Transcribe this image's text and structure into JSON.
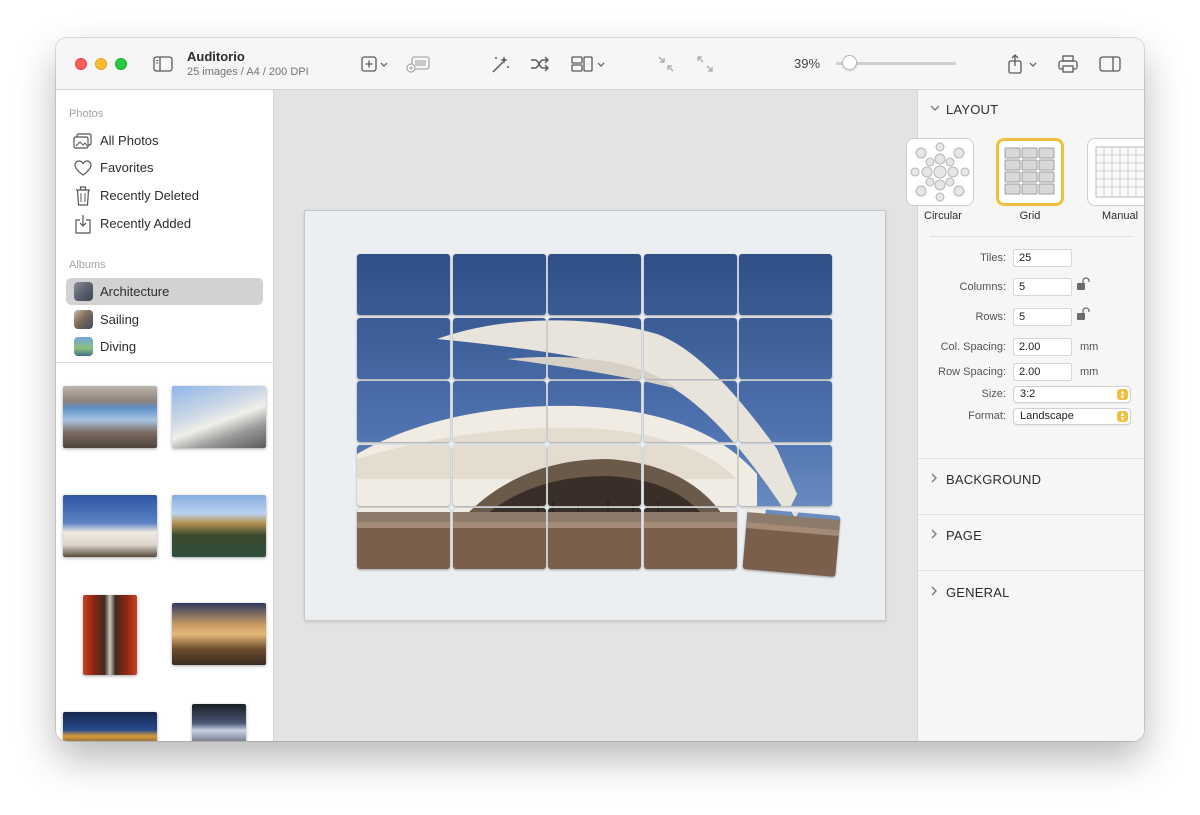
{
  "window": {
    "title": "Auditorio",
    "subtitle": "25 images / A4 / 200 DPI",
    "zoom": "39%",
    "zoom_fraction": 0.05
  },
  "toolbar_icons": [
    "sidebar-toggle-icon",
    "add-icon",
    "chevron-down-icon",
    "add-to-photo-icon",
    "magic-wand-icon",
    "shuffle-icon",
    "layout-icon",
    "collapse-icon",
    "expand-icon",
    "share-icon",
    "print-icon",
    "inspector-toggle-icon"
  ],
  "sidebar": {
    "photos_label": "Photos",
    "photos": [
      {
        "label": "All Photos",
        "icon": "photos-icon"
      },
      {
        "label": "Favorites",
        "icon": "heart-icon"
      },
      {
        "label": "Recently Deleted",
        "icon": "trash-icon"
      },
      {
        "label": "Recently Added",
        "icon": "import-icon"
      }
    ],
    "albums_label": "Albums",
    "albums": [
      {
        "label": "Architecture",
        "selected": true
      },
      {
        "label": "Sailing",
        "selected": false
      },
      {
        "label": "Diving",
        "selected": false
      }
    ]
  },
  "inspector": {
    "layout": {
      "header": "LAYOUT",
      "options": [
        {
          "label": "Circular"
        },
        {
          "label": "Grid",
          "selected": true
        },
        {
          "label": "Manual"
        }
      ],
      "tiles_label": "Tiles:",
      "tiles_value": "25",
      "columns_label": "Columns:",
      "columns_value": "5",
      "rows_label": "Rows:",
      "rows_value": "5",
      "col_spacing_label": "Col. Spacing:",
      "col_spacing_value": "2.00",
      "col_spacing_unit": "mm",
      "row_spacing_label": "Row Spacing:",
      "row_spacing_value": "2.00",
      "row_spacing_unit": "mm",
      "size_label": "Size:",
      "size_value": "3:2",
      "format_label": "Format:",
      "format_value": "Landscape"
    },
    "background_header": "BACKGROUND",
    "page_header": "PAGE",
    "general_header": "GENERAL"
  },
  "colors": {
    "accent": "#f1bf3f",
    "selection": "#d2d2d2"
  }
}
